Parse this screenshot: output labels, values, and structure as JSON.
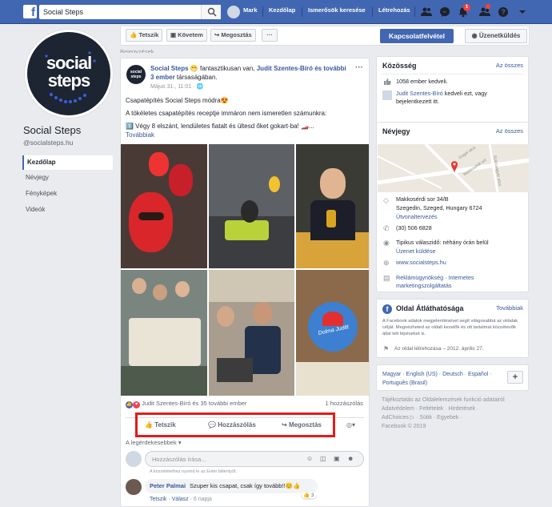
{
  "topbar": {
    "search_value": "Social Steps",
    "user_name": "Mark",
    "nav_home": "Kezdőlap",
    "nav_friends": "Ismerősök keresése",
    "nav_create": "Létrehozás",
    "notif_count": "1"
  },
  "left": {
    "page_name": "Social Steps",
    "handle": "@socialsteps.hu",
    "logo_line1": "social",
    "logo_line2": "steps",
    "nav": [
      "Kezdőlap",
      "Névjegy",
      "Fényképek",
      "Videók"
    ]
  },
  "actions": {
    "like": "Tetszik",
    "follow": "Követem",
    "share": "Megosztás",
    "more": "···",
    "contact": "Kapcsolatfelvétel",
    "message": "Üzenetküldés"
  },
  "post": {
    "above_label": "Bejegyzések",
    "author": "Social Steps",
    "feeling": "fantasztikusan van, ",
    "tagged": "Judit Szentes-Bíró és",
    "tagged2": "további 3 ember",
    "tagged_suffix": " társaságában.",
    "date": "Május 31., 11:01",
    "line1": "Csapatépítés Social Steps módra😍",
    "line2": "A tökéletes csapatépítés receptje immáron nem ismeretlen számunkra:",
    "line3": "1️⃣ Végy 8 elszánt, lendületes fiatalt és ültesd őket gokart-ba! 🏎️...",
    "more": "Továbbiak",
    "cake_text": "Dolma Juditt",
    "reactions": "Judit Szentes-Bíró és 35 további ember",
    "comments_count": "1 hozzászólás",
    "act_like": "Tetszik",
    "act_comment": "Hozzászólás",
    "act_share": "Megosztás",
    "sort_label": "A legérdekesebbek",
    "comment_placeholder": "Hozzászólás írása...",
    "enter_hint": "A közzétételhez nyomd le az Enter billentyűt.",
    "commenter": "Peter Palmai",
    "comment_text": "Szuper kis csapat, csak így tovább!!😊👍",
    "comment_like": "Tetszik",
    "comment_reply": "Válasz",
    "comment_age": "6 napja",
    "comment_reacts": "3"
  },
  "community": {
    "title": "Közösség",
    "see_all": "Az összes",
    "likes": "1058 ember kedveli.",
    "friend": "Judit Szentes-Bíró",
    "friend_text": " kedveli ezt, vagy bejelentkezett itt."
  },
  "about": {
    "title": "Névjegy",
    "see_all": "Az összes",
    "address1": "Makkosérdi sor 34/B",
    "address2": "Szegedin, Szeged, Hungary 6724",
    "directions": "Útvonaltervezés",
    "phone": "(30) 506 6828",
    "response": "Tipikus válaszidő: néhány órán belül",
    "send_msg": "Üzenet küldése",
    "website": "www.socialsteps.hu",
    "category": "Reklámügynökség · Internetes marketingszolgáltatás",
    "map_street1": "Makkosérdi sor",
    "map_street2": "Gogol utca",
    "map_street3": "Szárcsagyár utca"
  },
  "transparency": {
    "title": "Oldal Átláthatósága",
    "more": "Továbbiak",
    "text": "A Facebook adatok megjelenítésével segít világosabbá az oldalak célját. Megnézheted az oldalt kezelők és ott tartalmat közzétevők által tett lépéseket is.",
    "created": "Az oldal létrehozása – 2012. április 27."
  },
  "languages": {
    "list": "Magyar · English (US) · Deutsch · Español · Português (Brasil)",
    "add": "+"
  },
  "footer": {
    "line1": "Tájékoztatás az Oldalelemzések funkció adatairól",
    "line2": "Adatvédelem · Feltételek · Hirdetések ·",
    "line3": "AdChoices ▷ · Sütik · Egyebek ·",
    "line4": "Facebook © 2019"
  },
  "colors": {
    "brand": "#4267b2",
    "highlight_box": "#e31b1b"
  }
}
